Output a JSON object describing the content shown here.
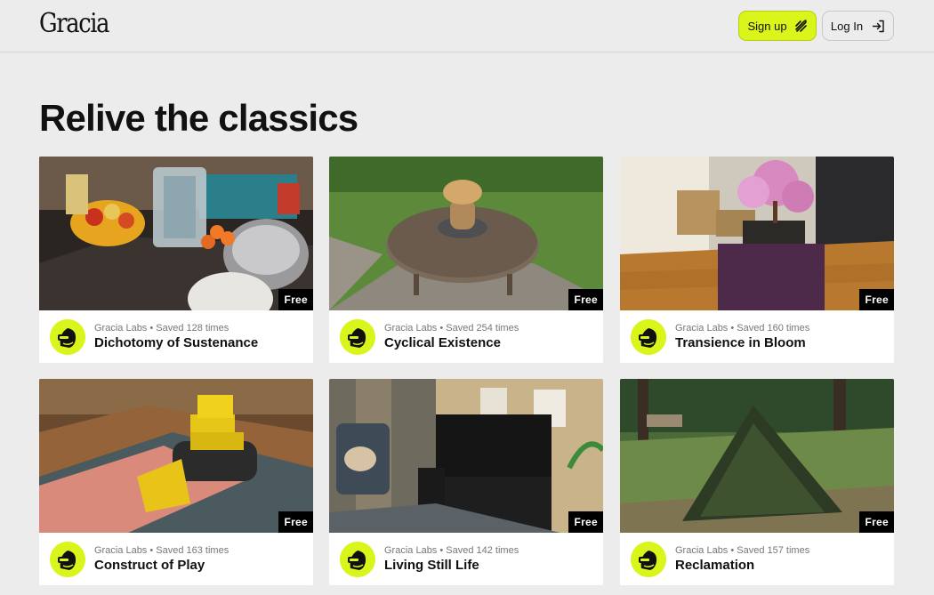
{
  "header": {
    "logo": "Gracia",
    "signup_label": "Sign up",
    "login_label": "Log In"
  },
  "page": {
    "title": "Relive the classics"
  },
  "cards": [
    {
      "title": "Dichotomy of Sustenance",
      "author": "Gracia Labs",
      "saved": "Saved 128 times",
      "badge": "Free"
    },
    {
      "title": "Cyclical Existence",
      "author": "Gracia Labs",
      "saved": "Saved 254 times",
      "badge": "Free"
    },
    {
      "title": "Transience in Bloom",
      "author": "Gracia Labs",
      "saved": "Saved 160 times",
      "badge": "Free"
    },
    {
      "title": "Construct of Play",
      "author": "Gracia Labs",
      "saved": "Saved 163 times",
      "badge": "Free"
    },
    {
      "title": "Living Still Life",
      "author": "Gracia Labs",
      "saved": "Saved 142 times",
      "badge": "Free"
    },
    {
      "title": "Reclamation",
      "author": "Gracia Labs",
      "saved": "Saved 157 times",
      "badge": "Free"
    }
  ],
  "colors": {
    "accent": "#d9f51c",
    "background": "#ececec",
    "badge_bg": "#000000"
  },
  "icons": {
    "signup": "wave-lines-icon",
    "login": "log-in-arrow-icon",
    "avatar": "gracia-labs-avatar-icon"
  }
}
